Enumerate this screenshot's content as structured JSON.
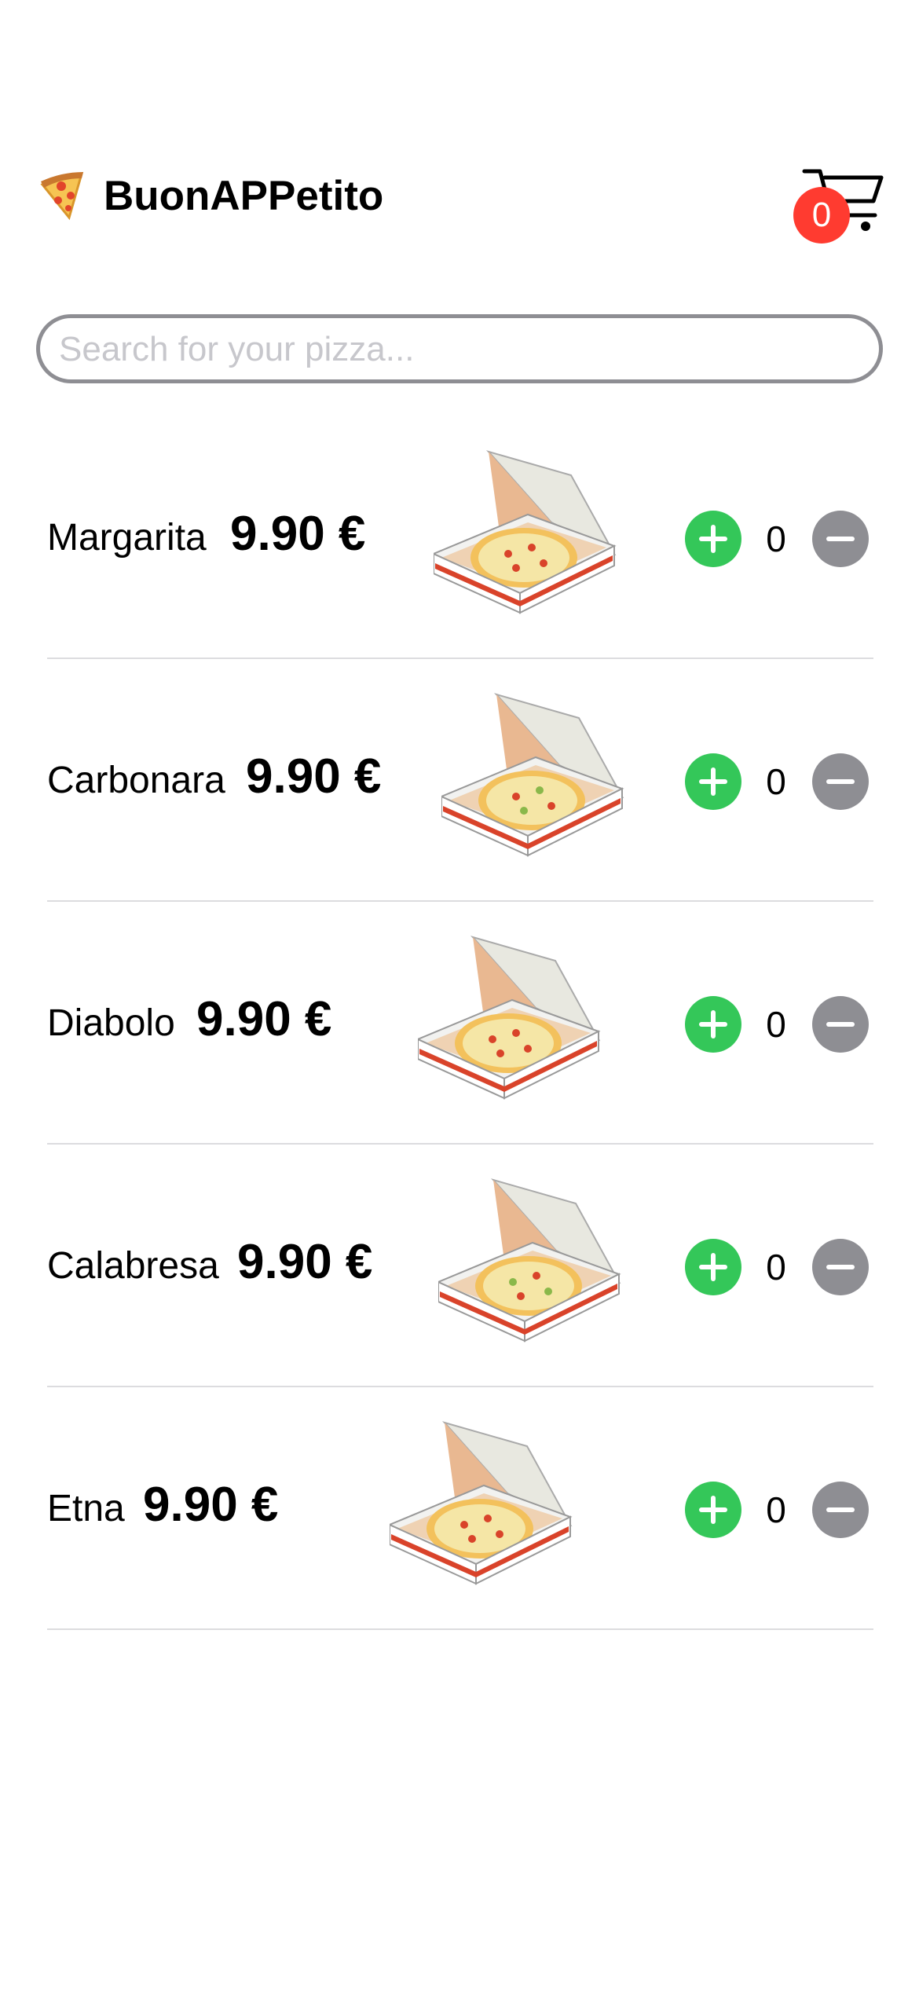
{
  "header": {
    "title": "BuonAPPetito",
    "cart_count": "0"
  },
  "search": {
    "placeholder": "Search for your pizza...",
    "value": ""
  },
  "pizzas": [
    {
      "name": "Margarita",
      "price": "9.90 €",
      "quantity": "0"
    },
    {
      "name": "Carbonara",
      "price": "9.90 €",
      "quantity": "0"
    },
    {
      "name": "Diabolo",
      "price": "9.90 €",
      "quantity": "0"
    },
    {
      "name": "Calabresa",
      "price": "9.90 €",
      "quantity": "0"
    },
    {
      "name": "Etna",
      "price": "9.90 €",
      "quantity": "0"
    }
  ],
  "colors": {
    "add": "#34c759",
    "remove": "#8e8e93",
    "badge": "#ff3b30"
  },
  "icons": {
    "logo": "pizza-slice-icon",
    "cart": "cart-icon",
    "add": "plus-circle-icon",
    "remove": "minus-circle-icon",
    "item": "pizza-box-icon"
  }
}
